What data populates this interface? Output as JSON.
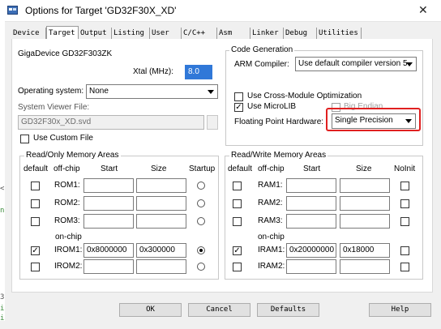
{
  "window": {
    "title": "Options for Target 'GD32F30X_XD'",
    "close": "✕"
  },
  "tabs": [
    "Device",
    "Target",
    "Output",
    "Listing",
    "User",
    "C/C++",
    "Asm",
    "Linker",
    "Debug",
    "Utilities"
  ],
  "left": {
    "device_name": "GigaDevice GD32F303ZK",
    "xtal_label": "Xtal (MHz):",
    "xtal_value": "8.0",
    "os_label": "Operating system:",
    "os_value": "None",
    "svd_label": "System Viewer File:",
    "svd_value": "GD32F30x_XD.svd",
    "custom_file_label": "Use Custom File"
  },
  "codegen": {
    "legend": "Code Generation",
    "compiler_label": "ARM Compiler:",
    "compiler_value": "Use default compiler version 5",
    "cross_module_label": "Use Cross-Module Optimization",
    "microlib_label": "Use MicroLIB",
    "microlib_check": "✓",
    "endian_label": "Big Endian",
    "fp_label": "Floating Point Hardware:",
    "fp_value": "Single Precision",
    "highlight_color": "#e02020"
  },
  "rom": {
    "legend": "Read/Only Memory Areas",
    "headers": {
      "default": "default",
      "offchip": "off-chip",
      "start": "Start",
      "size": "Size",
      "startup": "Startup"
    },
    "onchip_label": "on-chip",
    "rows": [
      {
        "label": "ROM1:",
        "start": "",
        "size": "",
        "default": "",
        "startup": false
      },
      {
        "label": "ROM2:",
        "start": "",
        "size": "",
        "default": "",
        "startup": false
      },
      {
        "label": "ROM3:",
        "start": "",
        "size": "",
        "default": "",
        "startup": false
      },
      {
        "label": "IROM1:",
        "start": "0x8000000",
        "size": "0x300000",
        "default": "✓",
        "startup": true
      },
      {
        "label": "IROM2:",
        "start": "",
        "size": "",
        "default": "",
        "startup": false
      }
    ]
  },
  "ram": {
    "legend": "Read/Write Memory Areas",
    "headers": {
      "default": "default",
      "offchip": "off-chip",
      "start": "Start",
      "size": "Size",
      "noinit": "NoInit"
    },
    "onchip_label": "on-chip",
    "rows": [
      {
        "label": "RAM1:",
        "start": "",
        "size": "",
        "default": ""
      },
      {
        "label": "RAM2:",
        "start": "",
        "size": "",
        "default": ""
      },
      {
        "label": "RAM3:",
        "start": "",
        "size": "",
        "default": ""
      },
      {
        "label": "IRAM1:",
        "start": "0x20000000",
        "size": "0x18000",
        "default": "✓"
      },
      {
        "label": "IRAM2:",
        "start": "",
        "size": "",
        "default": ""
      }
    ]
  },
  "buttons": {
    "ok": "OK",
    "cancel": "Cancel",
    "defaults": "Defaults",
    "help": "Help"
  },
  "side_glyphs": [
    "<",
    "n",
    "3",
    "i",
    "i"
  ]
}
